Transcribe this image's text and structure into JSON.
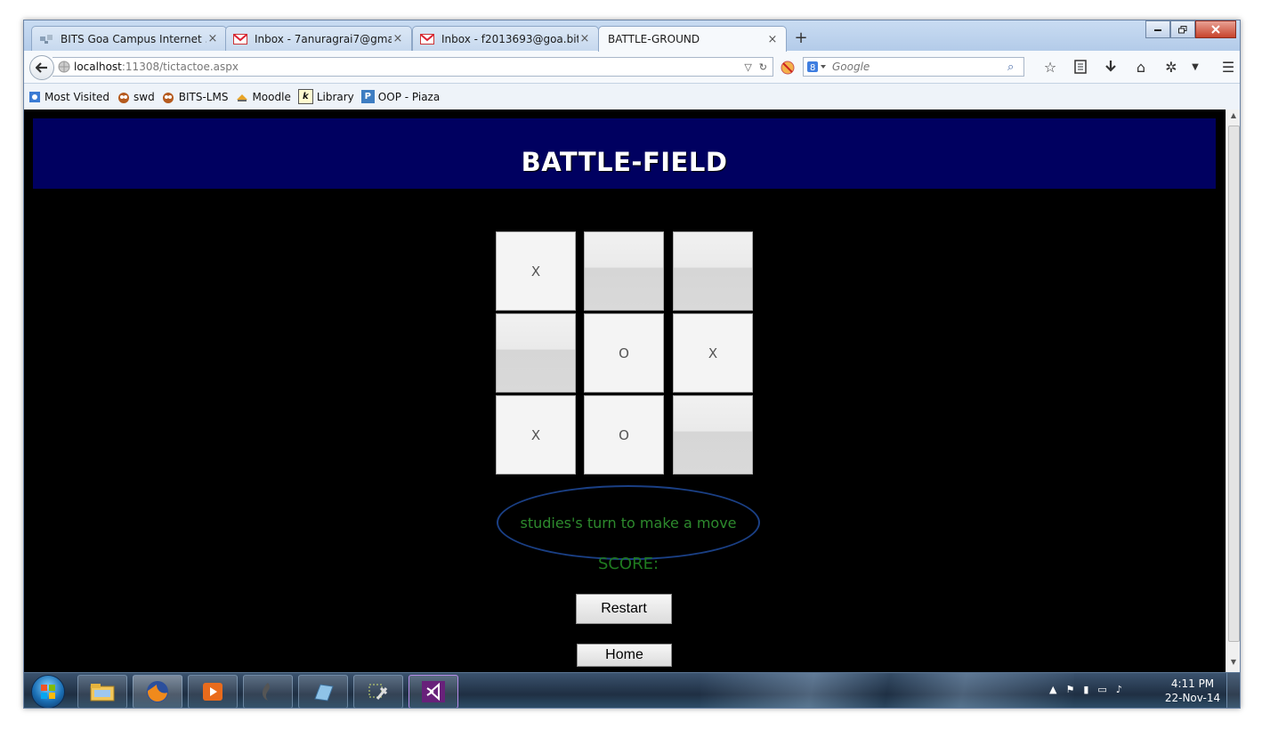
{
  "browser": {
    "tabs": [
      {
        "label": "BITS Goa Campus Internet ...",
        "icon": "network-icon",
        "active": false
      },
      {
        "label": "Inbox - 7anuragrai7@gmail...",
        "icon": "gmail-icon",
        "active": false
      },
      {
        "label": "Inbox - f2013693@goa.bits...",
        "icon": "gmail-icon",
        "active": false
      },
      {
        "label": "BATTLE-GROUND",
        "icon": "",
        "active": true
      }
    ],
    "tab_close_glyph": "×",
    "new_tab_glyph": "+",
    "url_host": "localhost",
    "url_path": ":11308/tictactoe.aspx",
    "search_placeholder": "Google",
    "bookmarks": [
      {
        "label": "Most Visited",
        "icon": "most-visited-icon"
      },
      {
        "label": "swd",
        "icon": "owl-icon"
      },
      {
        "label": "BITS-LMS",
        "icon": "owl-icon"
      },
      {
        "label": "Moodle",
        "icon": "moodle-icon"
      },
      {
        "label": "Library",
        "icon": "library-icon"
      },
      {
        "label": "OOP - Piaza",
        "icon": "piazza-icon"
      }
    ]
  },
  "page": {
    "title": "BATTLE-FIELD",
    "board": [
      "X",
      "",
      "",
      "",
      "O",
      "X",
      "X",
      "O",
      ""
    ],
    "turn_message": "studies's turn to make a move",
    "score_label": "SCORE:",
    "restart_label": "Restart",
    "home_label": "Home"
  },
  "taskbar": {
    "time": "4:11 PM",
    "date": "22-Nov-14",
    "apps": [
      "file-explorer-icon",
      "firefox-icon",
      "media-player-icon",
      "app-icon",
      "notepad-icon",
      "tools-icon",
      "visual-studio-icon"
    ]
  },
  "colors": {
    "banner": "#000060",
    "turn_text": "#2d8a2d",
    "ellipse_border": "#1a3f84",
    "content_bg": "#000000"
  }
}
